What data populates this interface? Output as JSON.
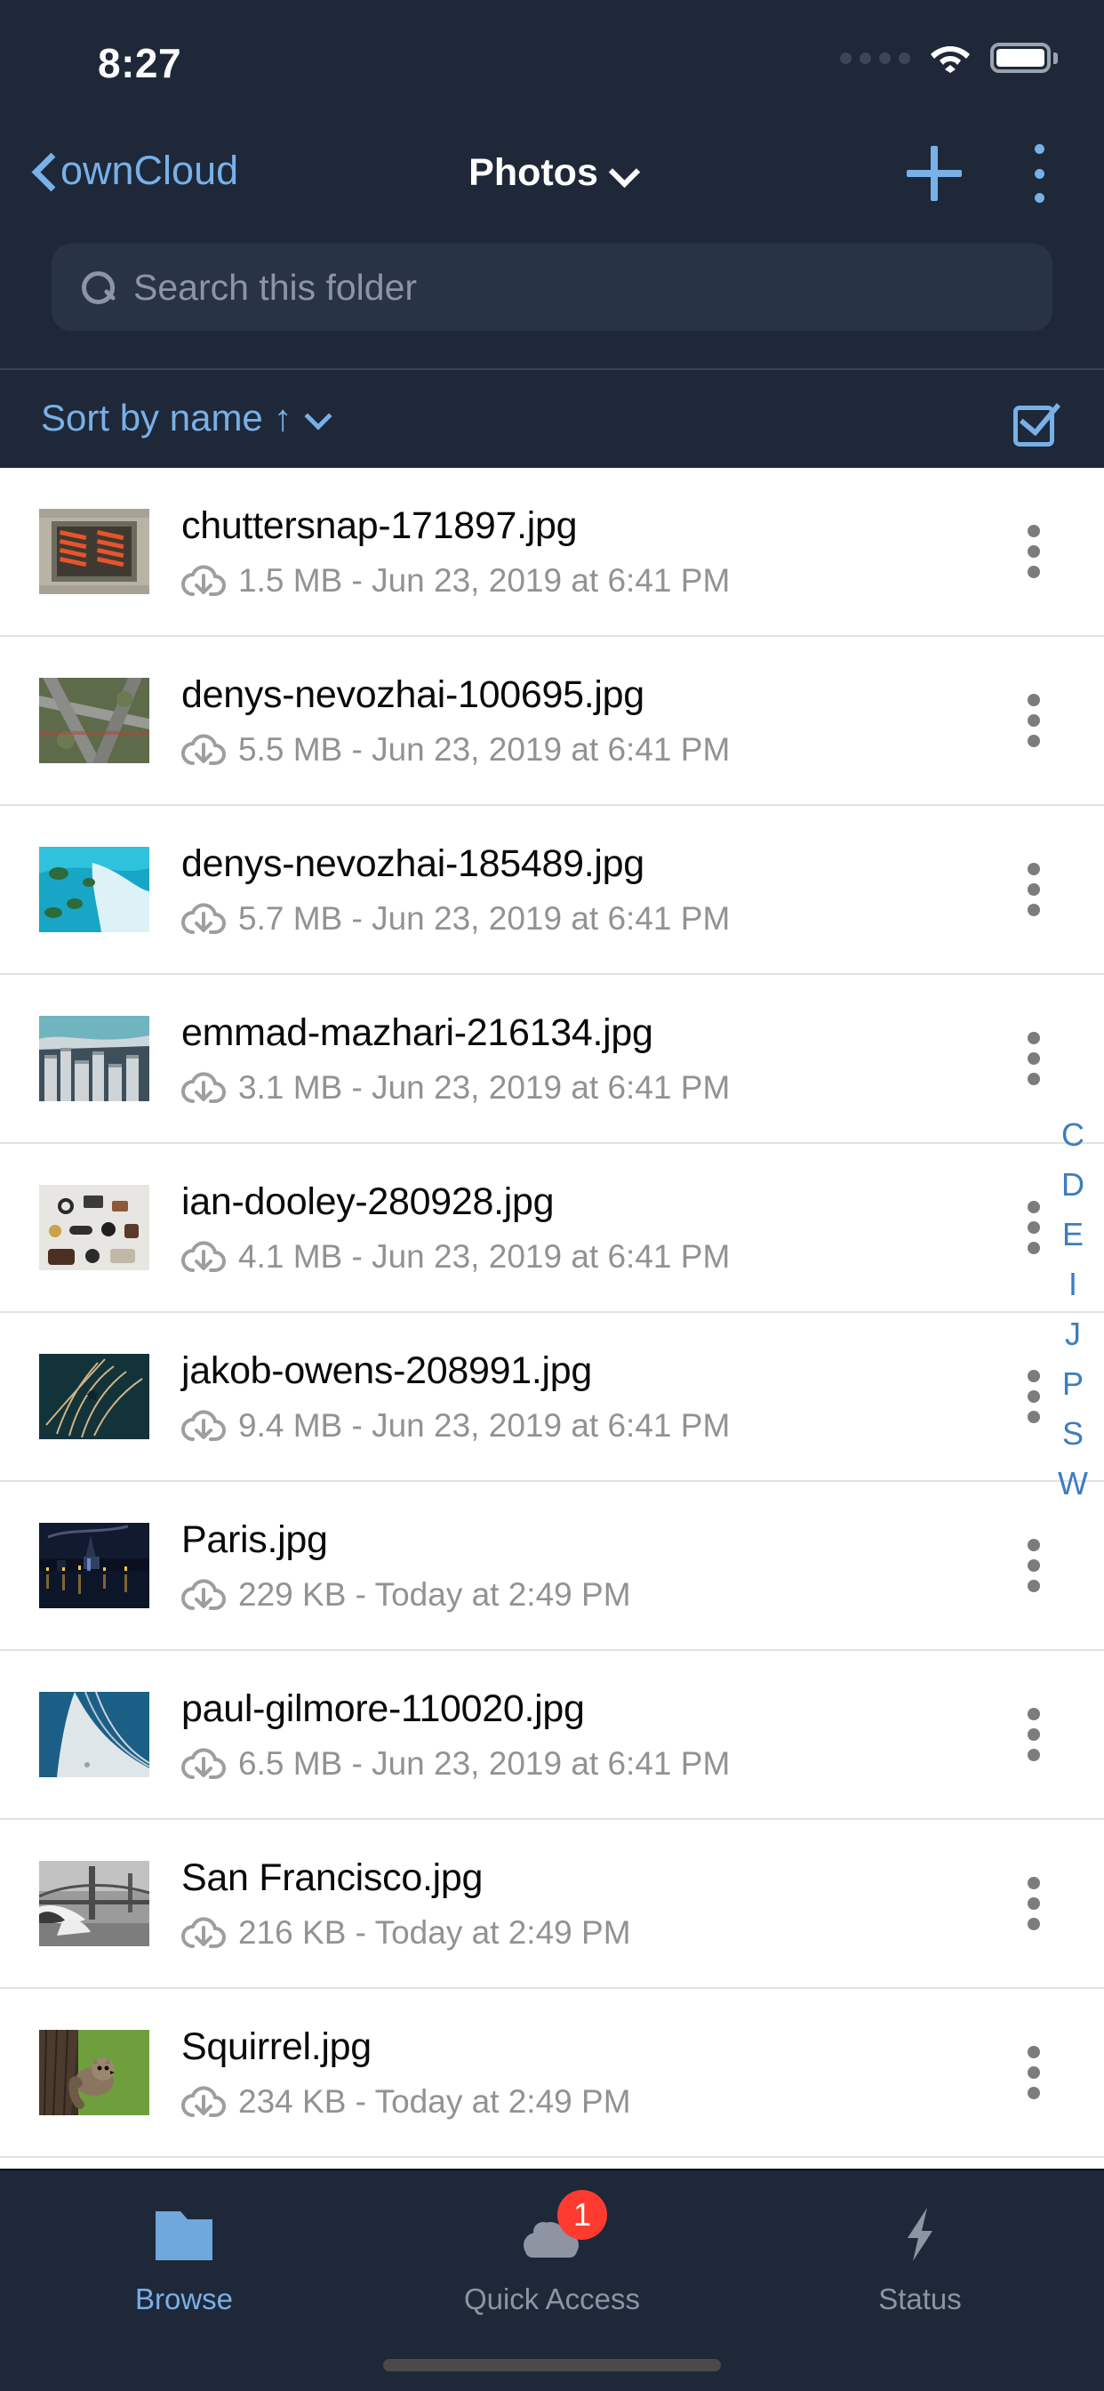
{
  "status_bar": {
    "time": "8:27",
    "signal_icon": "signal-dots-icon",
    "wifi_icon": "wifi-icon",
    "battery_icon": "battery-full-icon"
  },
  "nav_bar": {
    "back_label": "ownCloud",
    "back_icon": "chevron-left-icon",
    "title": "Photos",
    "title_chevron_icon": "chevron-down-icon",
    "add_icon": "plus-icon",
    "more_icon": "kebab-menu-icon"
  },
  "search": {
    "placeholder": "Search this folder",
    "value": "",
    "icon": "search-icon"
  },
  "sort_bar": {
    "label": "Sort by name",
    "direction_arrow": "↑",
    "chevron_icon": "chevron-down-icon",
    "select_all_icon": "checkbox-checked-icon"
  },
  "files": [
    {
      "name": "chuttersnap-171897.jpg",
      "detail": "1.5 MB - Jun 23, 2019 at 6:41 PM",
      "size": "1.5 MB",
      "date": "Jun 23, 2019 at 6:41 PM",
      "cloud_icon": "cloud-download-icon",
      "more_icon": "kebab-menu-icon",
      "thumb": "orange-buses-aerial"
    },
    {
      "name": "denys-nevozhai-100695.jpg",
      "detail": "5.5 MB - Jun 23, 2019 at 6:41 PM",
      "size": "5.5 MB",
      "date": "Jun 23, 2019 at 6:41 PM",
      "cloud_icon": "cloud-download-icon",
      "more_icon": "kebab-menu-icon",
      "thumb": "highway-interchange-aerial"
    },
    {
      "name": "denys-nevozhai-185489.jpg",
      "detail": "5.7 MB - Jun 23, 2019 at 6:41 PM",
      "size": "5.7 MB",
      "date": "Jun 23, 2019 at 6:41 PM",
      "cloud_icon": "cloud-download-icon",
      "more_icon": "kebab-menu-icon",
      "thumb": "turquoise-lagoon-islands"
    },
    {
      "name": "emmad-mazhari-216134.jpg",
      "detail": "3.1 MB - Jun 23, 2019 at 6:41 PM",
      "size": "3.1 MB",
      "date": "Jun 23, 2019 at 6:41 PM",
      "cloud_icon": "cloud-download-icon",
      "more_icon": "kebab-menu-icon",
      "thumb": "city-skyscrapers-aerial"
    },
    {
      "name": "ian-dooley-280928.jpg",
      "detail": "4.1 MB - Jun 23, 2019 at 6:41 PM",
      "size": "4.1 MB",
      "date": "Jun 23, 2019 at 6:41 PM",
      "cloud_icon": "cloud-download-icon",
      "more_icon": "kebab-menu-icon",
      "thumb": "flatlay-objects-white"
    },
    {
      "name": "jakob-owens-208991.jpg",
      "detail": "9.4 MB - Jun 23, 2019 at 6:41 PM",
      "size": "9.4 MB",
      "date": "Jun 23, 2019 at 6:41 PM",
      "cloud_icon": "cloud-download-icon",
      "more_icon": "kebab-menu-icon",
      "thumb": "teal-sparkler-light"
    },
    {
      "name": "Paris.jpg",
      "detail": "229 KB - Today at 2:49 PM",
      "size": "229 KB",
      "date": "Today at 2:49 PM",
      "cloud_icon": "cloud-download-icon",
      "more_icon": "kebab-menu-icon",
      "thumb": "paris-night-river"
    },
    {
      "name": "paul-gilmore-110020.jpg",
      "detail": "6.5 MB - Jun 23, 2019 at 6:41 PM",
      "size": "6.5 MB",
      "date": "Jun 23, 2019 at 6:41 PM",
      "cloud_icon": "cloud-download-icon",
      "more_icon": "kebab-menu-icon",
      "thumb": "blue-snow-slope"
    },
    {
      "name": "San Francisco.jpg",
      "detail": "216 KB - Today at 2:49 PM",
      "size": "216 KB",
      "date": "Today at 2:49 PM",
      "cloud_icon": "cloud-download-icon",
      "more_icon": "kebab-menu-icon",
      "thumb": "golden-gate-bw"
    },
    {
      "name": "Squirrel.jpg",
      "detail": "234 KB - Today at 2:49 PM",
      "size": "234 KB",
      "date": "Today at 2:49 PM",
      "cloud_icon": "cloud-download-icon",
      "more_icon": "kebab-menu-icon",
      "thumb": "squirrel-green"
    }
  ],
  "index_strip": [
    "C",
    "D",
    "E",
    "I",
    "J",
    "P",
    "S",
    "W"
  ],
  "tab_bar": {
    "tabs": [
      {
        "label": "Browse",
        "icon": "folder-icon",
        "active": true,
        "badge": ""
      },
      {
        "label": "Quick Access",
        "icon": "cloud-icon",
        "active": false,
        "badge": "1"
      },
      {
        "label": "Status",
        "icon": "lightning-bolt-icon",
        "active": false,
        "badge": ""
      }
    ]
  },
  "colors": {
    "chrome_bg": "#1e2838",
    "accent_blue": "#78b0e8",
    "index_blue": "#3c7dc0",
    "list_bg": "#ffffff",
    "badge_red": "#ff3b30",
    "meta_gray": "#929292"
  }
}
